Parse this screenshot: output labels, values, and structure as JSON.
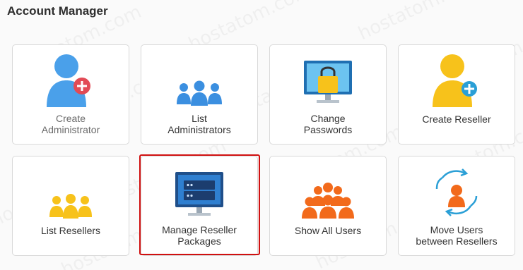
{
  "page": {
    "title": "Account Manager"
  },
  "watermark": "hostatom.com",
  "colors": {
    "blue": "#3b8fe0",
    "yellow": "#f7c21b",
    "orange": "#f26a1b",
    "red": "#e24a55",
    "teal": "#2a9fd6",
    "highlight": "#d01010"
  },
  "cards": [
    {
      "label_line1": "Create",
      "label_line2": "Administrator",
      "icon": "person-add-icon"
    },
    {
      "label_line1": "List",
      "label_line2": "Administrators",
      "icon": "people-group-blue-icon"
    },
    {
      "label_line1": "Change",
      "label_line2": "Passwords",
      "icon": "monitor-lock-icon"
    },
    {
      "label_line1": "Create Reseller",
      "label_line2": "",
      "icon": "person-add-yellow-icon"
    },
    {
      "label_line1": "List Resellers",
      "label_line2": "",
      "icon": "people-group-yellow-icon"
    },
    {
      "label_line1": "Manage Reseller",
      "label_line2": "Packages",
      "icon": "monitor-server-icon"
    },
    {
      "label_line1": "Show All Users",
      "label_line2": "",
      "icon": "people-group-orange-icon"
    },
    {
      "label_line1": "Move Users",
      "label_line2": "between Resellers",
      "icon": "person-transfer-icon"
    }
  ]
}
